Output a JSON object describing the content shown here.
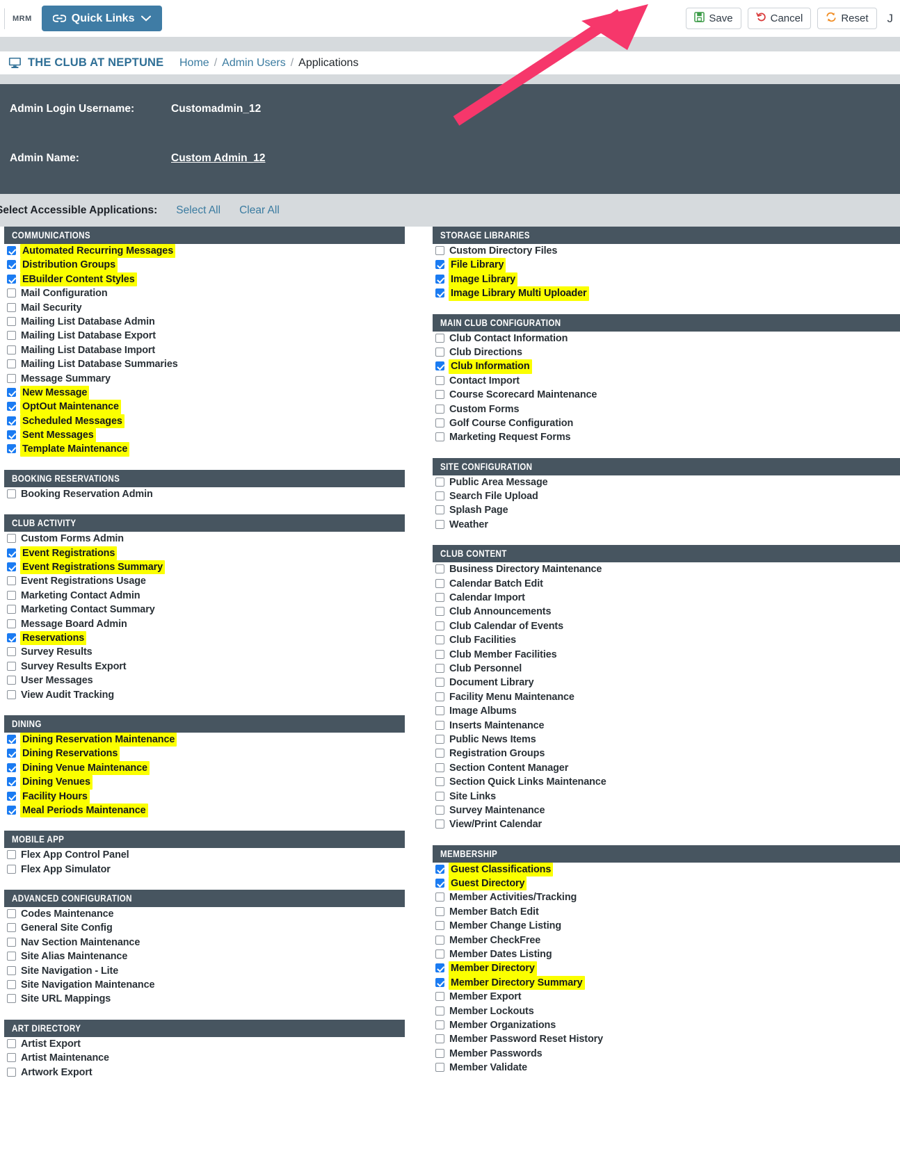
{
  "topbar": {
    "app_abbr": "MRM",
    "quick_links_label": "Quick Links",
    "save_label": "Save",
    "cancel_label": "Cancel",
    "reset_label": "Reset",
    "user_initial": "J"
  },
  "breadcrumb": {
    "club_name": "THE CLUB AT NEPTUNE COVE",
    "home": "Home",
    "sep": "/",
    "admin_users": "Admin Users",
    "current": "Applications"
  },
  "admin": {
    "username_label": "Admin Login Username:",
    "username_value": "Customadmin_12",
    "name_label": "Admin Name:",
    "name_value": "Custom Admin_12"
  },
  "selector": {
    "title": "Select Accessible Applications:",
    "select_all": "Select All",
    "clear_all": "Clear All"
  },
  "colors": {
    "panel_dark": "#475560",
    "band_gray": "#d6dadd",
    "link_blue": "#3a7ba0",
    "checkbox_blue": "#1a7bf2",
    "highlight_yellow": "#fbff00",
    "quick_links_blue": "#3f7ca5",
    "arrow_pink": "#f6376b",
    "save_green": "#3c9b47",
    "cancel_red": "#d93a3a",
    "reset_orange": "#f08a1e"
  },
  "left_column": [
    {
      "title": "COMMUNICATIONS",
      "items": [
        {
          "label": "Automated Recurring Messages",
          "checked": true
        },
        {
          "label": "Distribution Groups",
          "checked": true
        },
        {
          "label": "EBuilder Content Styles",
          "checked": true
        },
        {
          "label": "Mail Configuration",
          "checked": false
        },
        {
          "label": "Mail Security",
          "checked": false
        },
        {
          "label": "Mailing List Database Admin",
          "checked": false
        },
        {
          "label": "Mailing List Database Export",
          "checked": false
        },
        {
          "label": "Mailing List Database Import",
          "checked": false
        },
        {
          "label": "Mailing List Database Summaries",
          "checked": false
        },
        {
          "label": "Message Summary",
          "checked": false
        },
        {
          "label": "New Message",
          "checked": true
        },
        {
          "label": "OptOut Maintenance",
          "checked": true
        },
        {
          "label": "Scheduled Messages",
          "checked": true
        },
        {
          "label": "Sent Messages",
          "checked": true
        },
        {
          "label": "Template Maintenance",
          "checked": true
        }
      ]
    },
    {
      "title": "BOOKING RESERVATIONS",
      "items": [
        {
          "label": "Booking Reservation Admin",
          "checked": false
        }
      ]
    },
    {
      "title": "CLUB ACTIVITY",
      "items": [
        {
          "label": "Custom Forms Admin",
          "checked": false
        },
        {
          "label": "Event Registrations",
          "checked": true
        },
        {
          "label": "Event Registrations Summary",
          "checked": true
        },
        {
          "label": "Event Registrations Usage",
          "checked": false
        },
        {
          "label": "Marketing Contact Admin",
          "checked": false
        },
        {
          "label": "Marketing Contact Summary",
          "checked": false
        },
        {
          "label": "Message Board Admin",
          "checked": false
        },
        {
          "label": "Reservations",
          "checked": true
        },
        {
          "label": "Survey Results",
          "checked": false
        },
        {
          "label": "Survey Results Export",
          "checked": false
        },
        {
          "label": "User Messages",
          "checked": false
        },
        {
          "label": "View Audit Tracking",
          "checked": false
        }
      ]
    },
    {
      "title": "DINING",
      "items": [
        {
          "label": "Dining Reservation Maintenance",
          "checked": true
        },
        {
          "label": "Dining Reservations",
          "checked": true
        },
        {
          "label": "Dining Venue Maintenance",
          "checked": true
        },
        {
          "label": "Dining Venues",
          "checked": true
        },
        {
          "label": "Facility Hours",
          "checked": true
        },
        {
          "label": "Meal Periods Maintenance",
          "checked": true
        }
      ]
    },
    {
      "title": "MOBILE APP",
      "items": [
        {
          "label": "Flex App Control Panel",
          "checked": false
        },
        {
          "label": "Flex App Simulator",
          "checked": false
        }
      ]
    },
    {
      "title": "ADVANCED CONFIGURATION",
      "items": [
        {
          "label": "Codes Maintenance",
          "checked": false
        },
        {
          "label": "General Site Config",
          "checked": false
        },
        {
          "label": "Nav Section Maintenance",
          "checked": false
        },
        {
          "label": "Site Alias Maintenance",
          "checked": false
        },
        {
          "label": "Site Navigation - Lite",
          "checked": false
        },
        {
          "label": "Site Navigation Maintenance",
          "checked": false
        },
        {
          "label": "Site URL Mappings",
          "checked": false
        }
      ]
    },
    {
      "title": "ART DIRECTORY",
      "items": [
        {
          "label": "Artist Export",
          "checked": false
        },
        {
          "label": "Artist Maintenance",
          "checked": false
        },
        {
          "label": "Artwork Export",
          "checked": false
        }
      ]
    }
  ],
  "right_column": [
    {
      "title": "STORAGE LIBRARIES",
      "items": [
        {
          "label": "Custom Directory Files",
          "checked": false
        },
        {
          "label": "File Library",
          "checked": true
        },
        {
          "label": "Image Library",
          "checked": true
        },
        {
          "label": "Image Library Multi Uploader",
          "checked": true
        }
      ]
    },
    {
      "title": "MAIN CLUB CONFIGURATION",
      "items": [
        {
          "label": "Club Contact Information",
          "checked": false
        },
        {
          "label": "Club Directions",
          "checked": false
        },
        {
          "label": "Club Information",
          "checked": true
        },
        {
          "label": "Contact Import",
          "checked": false
        },
        {
          "label": "Course Scorecard Maintenance",
          "checked": false
        },
        {
          "label": "Custom Forms",
          "checked": false
        },
        {
          "label": "Golf Course Configuration",
          "checked": false
        },
        {
          "label": "Marketing Request Forms",
          "checked": false
        }
      ]
    },
    {
      "title": "SITE CONFIGURATION",
      "items": [
        {
          "label": "Public Area Message",
          "checked": false
        },
        {
          "label": "Search File Upload",
          "checked": false
        },
        {
          "label": "Splash Page",
          "checked": false
        },
        {
          "label": "Weather",
          "checked": false
        }
      ]
    },
    {
      "title": "CLUB CONTENT",
      "items": [
        {
          "label": "Business Directory Maintenance",
          "checked": false
        },
        {
          "label": "Calendar Batch Edit",
          "checked": false
        },
        {
          "label": "Calendar Import",
          "checked": false
        },
        {
          "label": "Club Announcements",
          "checked": false
        },
        {
          "label": "Club Calendar of Events",
          "checked": false
        },
        {
          "label": "Club Facilities",
          "checked": false
        },
        {
          "label": "Club Member Facilities",
          "checked": false
        },
        {
          "label": "Club Personnel",
          "checked": false
        },
        {
          "label": "Document Library",
          "checked": false
        },
        {
          "label": "Facility Menu Maintenance",
          "checked": false
        },
        {
          "label": "Image Albums",
          "checked": false
        },
        {
          "label": "Inserts Maintenance",
          "checked": false
        },
        {
          "label": "Public News Items",
          "checked": false
        },
        {
          "label": "Registration Groups",
          "checked": false
        },
        {
          "label": "Section Content Manager",
          "checked": false
        },
        {
          "label": "Section Quick Links Maintenance",
          "checked": false
        },
        {
          "label": "Site Links",
          "checked": false
        },
        {
          "label": "Survey Maintenance",
          "checked": false
        },
        {
          "label": "View/Print Calendar",
          "checked": false
        }
      ]
    },
    {
      "title": "MEMBERSHIP",
      "items": [
        {
          "label": "Guest Classifications",
          "checked": true
        },
        {
          "label": "Guest Directory",
          "checked": true
        },
        {
          "label": "Member Activities/Tracking",
          "checked": false
        },
        {
          "label": "Member Batch Edit",
          "checked": false
        },
        {
          "label": "Member Change Listing",
          "checked": false
        },
        {
          "label": "Member CheckFree",
          "checked": false
        },
        {
          "label": "Member Dates Listing",
          "checked": false
        },
        {
          "label": "Member Directory",
          "checked": true
        },
        {
          "label": "Member Directory Summary",
          "checked": true
        },
        {
          "label": "Member Export",
          "checked": false
        },
        {
          "label": "Member Lockouts",
          "checked": false
        },
        {
          "label": "Member Organizations",
          "checked": false
        },
        {
          "label": "Member Password Reset History",
          "checked": false
        },
        {
          "label": "Member Passwords",
          "checked": false
        },
        {
          "label": "Member Validate",
          "checked": false
        }
      ]
    }
  ]
}
